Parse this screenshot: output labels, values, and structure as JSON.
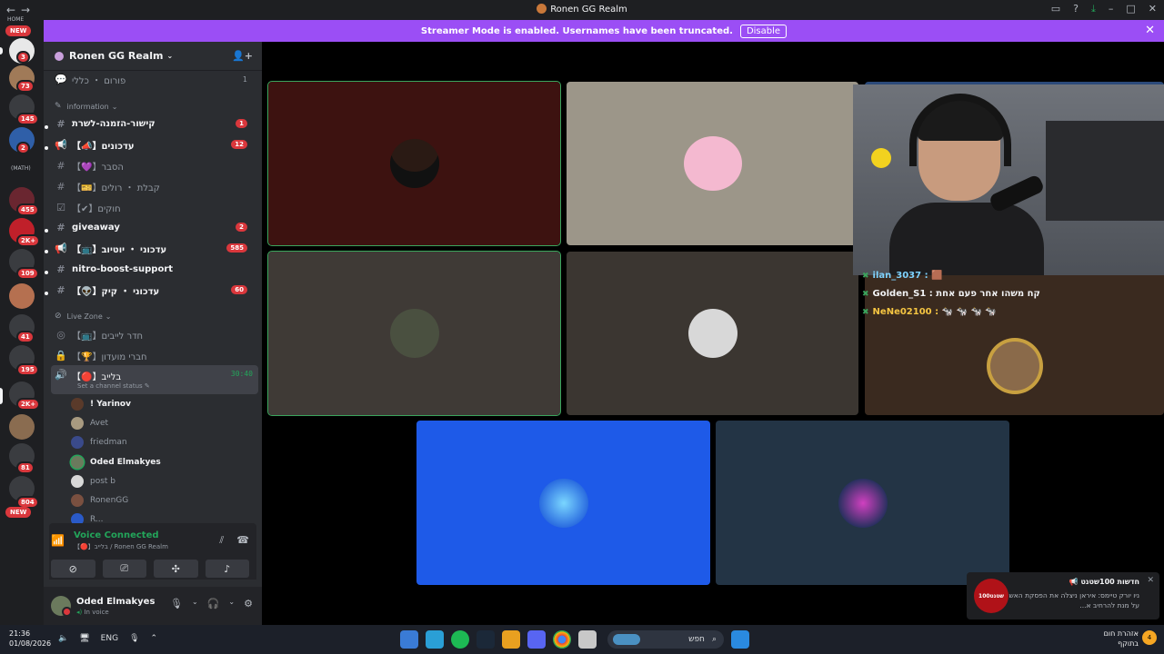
{
  "window": {
    "title": "Ronen GG Realm"
  },
  "banner": {
    "text": "Streamer Mode is enabled. Usernames have been truncated.",
    "disable_label": "Disable"
  },
  "guild_rail": {
    "top_label": "HOME",
    "badges": [
      "NEW",
      "3",
      "73",
      "145",
      "2",
      "455",
      "2K+",
      "109",
      "41",
      "195",
      "2K+",
      "81",
      "804",
      "NEW"
    ],
    "math_label": "(MATH)"
  },
  "server": {
    "name": "Ronen GG Realm"
  },
  "channels": [
    {
      "name": "פורום ・ כללי",
      "count": "1"
    },
    {
      "category": "information"
    },
    {
      "name": "קישור-הזמנה-לשרת",
      "badge": "1"
    },
    {
      "name": "【📣】עדכונים",
      "badge": "12"
    },
    {
      "name": "【💜】הסבר"
    },
    {
      "name": "【🎫】קבלת ・ רולים"
    },
    {
      "name": "【✔】חוקים"
    },
    {
      "name": "giveaway",
      "badge": "2"
    },
    {
      "name": "【📺】עדכוני ・ יוטיוב",
      "badge": "585"
    },
    {
      "name": "nitro-boost-support"
    },
    {
      "name": "【👽】עדכוני ・ קיק",
      "badge": "60"
    },
    {
      "category": "Live Zone"
    },
    {
      "name": "【📺】חדר לייבים"
    },
    {
      "name": "【🏆】חברי מועדון"
    },
    {
      "name": "【🔴】בלייב",
      "timer": "30:40",
      "status": "Set a channel status"
    }
  ],
  "voice_users": [
    "! Yarinov",
    "Avet",
    "friedman",
    "Oded Elmakyes",
    "post b",
    "RonenGG",
    "R..."
  ],
  "voice_panel": {
    "title": "Voice Connected",
    "subtitle": "【🔴】בלייב / Ronen GG Realm"
  },
  "user": {
    "name": "Oded Elmakyes",
    "status": "In voice"
  },
  "chat_lines": [
    {
      "user": "ilan_3037 :",
      "msg": "🟫"
    },
    {
      "user": "Golden_S1 :",
      "msg": "קח משהו אחר פעם אחת"
    },
    {
      "user": "NeNe02100 :",
      "msg": "🐄 🐄 🐄 🐄"
    }
  ],
  "toast": {
    "title": "חדשות 100שטנט 📢",
    "body": "ניו יורק טיימס: איראן ניצלה את הפסקת האש על מנת להרחיב א...",
    "logo": "100שטנט"
  },
  "taskbar": {
    "time": "21:36",
    "date": "01/08/2026",
    "lang": "ENG",
    "search": "חפש",
    "weather": "אזהרת חום",
    "weather_sub": "בתוקף",
    "weather_badge": "4"
  },
  "colors": {
    "accent": "#9b4ef5",
    "green": "#23a55a",
    "red": "#da373c"
  }
}
